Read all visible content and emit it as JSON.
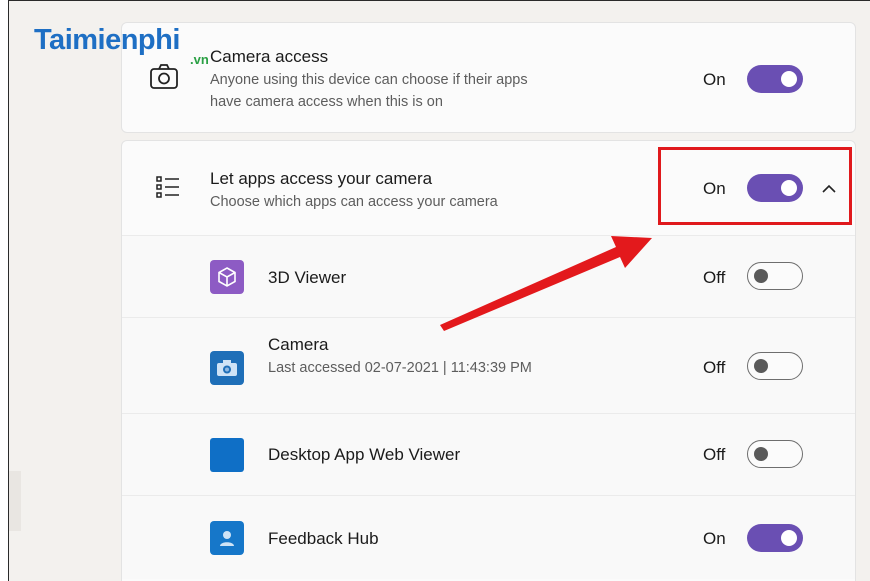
{
  "watermark": {
    "logo_text": "Taimienphi",
    "logo_suffix": ".vn"
  },
  "camera_access": {
    "title": "Camera access",
    "description": "Anyone using this device can choose if their apps have camera access when this is on",
    "state_label": "On",
    "icon": "camera-icon"
  },
  "let_apps": {
    "title": "Let apps access your camera",
    "description": "Choose which apps can access your camera",
    "state_label": "On",
    "icon": "list-icon",
    "expanded": true
  },
  "apps": [
    {
      "name": "3D Viewer",
      "detail": "",
      "state_label": "Off",
      "icon": "cube-icon",
      "color": "#8d5bc4"
    },
    {
      "name": "Camera",
      "detail": "Last accessed 02-07-2021  |  11:43:39 PM",
      "state_label": "Off",
      "icon": "camera-app-icon",
      "color": "#1f6fb8"
    },
    {
      "name": "Desktop App Web Viewer",
      "detail": "",
      "state_label": "Off",
      "icon": "square-app-icon",
      "color": "#0f6fc6"
    },
    {
      "name": "Feedback Hub",
      "detail": "",
      "state_label": "On",
      "icon": "feedback-icon",
      "color": "#1677c9"
    }
  ],
  "colors": {
    "toggle_on": "#6a4fb3",
    "highlight": "#e0191c",
    "arrow": "#e3191c"
  }
}
